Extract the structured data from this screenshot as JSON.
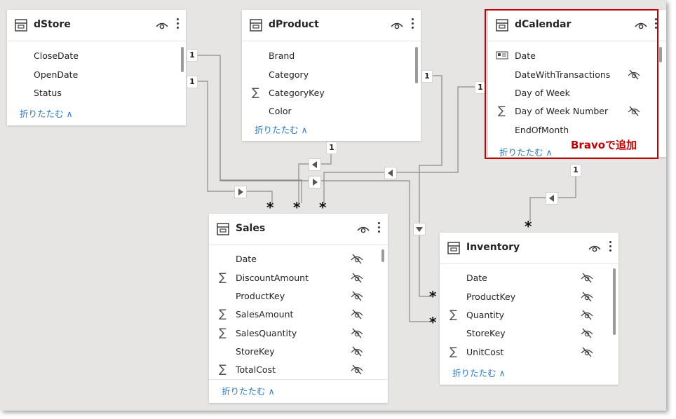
{
  "tables": {
    "dstore": {
      "title": "dStore",
      "fields": [
        "CloseDate",
        "OpenDate",
        "Status"
      ],
      "collapse_label": "折りたたむ ∧"
    },
    "dproduct": {
      "title": "dProduct",
      "fields": [
        "Brand",
        "Category",
        "CategoryKey",
        "Color"
      ],
      "collapse_label": "折りたたむ ∧"
    },
    "dcalendar": {
      "title": "dCalendar",
      "fields": [
        "Date",
        "DateWithTransactions",
        "Day of Week",
        "Day of Week Number",
        "EndOfMonth"
      ],
      "collapse_label": "折りたたむ ∧"
    },
    "sales": {
      "title": "Sales",
      "fields": [
        "Date",
        "DiscountAmount",
        "ProductKey",
        "SalesAmount",
        "SalesQuantity",
        "StoreKey",
        "TotalCost"
      ],
      "collapse_label": "折りたたむ ∧"
    },
    "inventory": {
      "title": "Inventory",
      "fields": [
        "Date",
        "ProductKey",
        "Quantity",
        "StoreKey",
        "UnitCost"
      ],
      "collapse_label": "折りたたむ ∧"
    }
  },
  "relationship": {
    "one_label": "1",
    "many_label": "*"
  },
  "annotation": {
    "text": "Bravoで追加",
    "color": "#c00000"
  },
  "colors": {
    "canvas": "#e6e5e4",
    "link": "#2b79c2",
    "line": "#8a8a8a"
  }
}
